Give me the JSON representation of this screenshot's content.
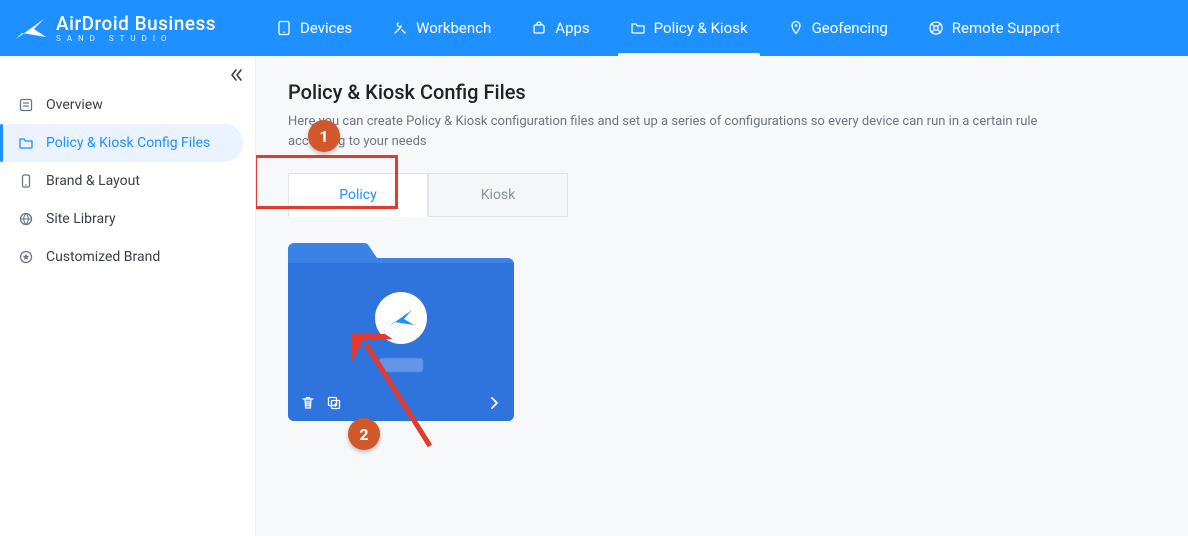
{
  "brand": {
    "title": "AirDroid Business",
    "subtitle": "SAND STUDIO"
  },
  "nav": {
    "devices": "Devices",
    "workbench": "Workbench",
    "apps": "Apps",
    "policy_kiosk": "Policy & Kiosk",
    "geofencing": "Geofencing",
    "remote_support": "Remote Support"
  },
  "sidebar": {
    "overview": "Overview",
    "config": "Policy & Kiosk Config Files",
    "brand_layout": "Brand & Layout",
    "site_library": "Site Library",
    "custom_brand": "Customized Brand"
  },
  "page": {
    "title": "Policy & Kiosk Config Files",
    "desc": "Here you can create Policy & Kiosk configuration files and set up a series of configurations so every device can run in a certain rule according to your needs"
  },
  "subtabs": {
    "policy": "Policy",
    "kiosk": "Kiosk"
  },
  "annotations": {
    "step1": "1",
    "step2": "2"
  }
}
